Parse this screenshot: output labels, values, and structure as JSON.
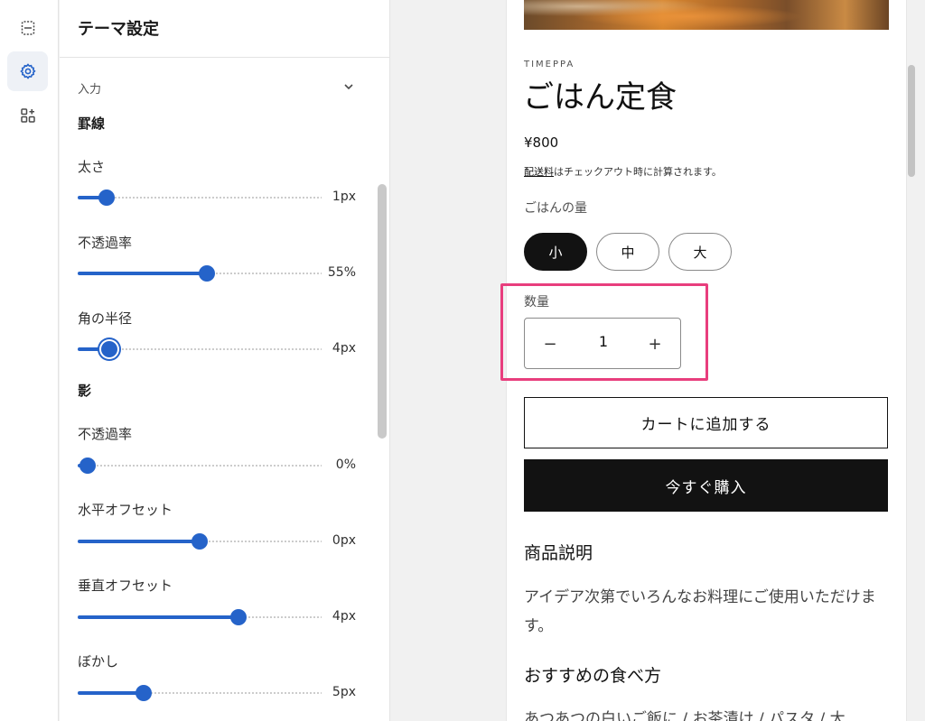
{
  "rail": {
    "items": [
      {
        "name": "sections-icon"
      },
      {
        "name": "settings-gear-icon"
      },
      {
        "name": "apps-add-icon"
      }
    ]
  },
  "panel": {
    "title": "テーマ設定",
    "section_label": "入力",
    "border_group": {
      "heading": "罫線",
      "settings": [
        {
          "label": "太さ",
          "value": "1px",
          "fraction": 0.12
        },
        {
          "label": "不透過率",
          "value": "55%",
          "fraction": 0.53
        },
        {
          "label": "角の半径",
          "value": "4px",
          "fraction": 0.13
        }
      ]
    },
    "shadow_group": {
      "heading": "影",
      "settings": [
        {
          "label": "不透過率",
          "value": "0%",
          "fraction": 0.04
        },
        {
          "label": "水平オフセット",
          "value": "0px",
          "fraction": 0.5
        },
        {
          "label": "垂直オフセット",
          "value": "4px",
          "fraction": 0.66
        },
        {
          "label": "ぼかし",
          "value": "5px",
          "fraction": 0.27
        }
      ]
    }
  },
  "preview": {
    "vendor": "TIMEPPA",
    "title": "ごはん定食",
    "price": "¥800",
    "shipping_link": "配送料",
    "shipping_rest": "はチェックアウト時に計算されます。",
    "variant_label": "ごはんの量",
    "variants": [
      "小",
      "中",
      "大"
    ],
    "selected_variant": "小",
    "quantity_label": "数量",
    "quantity_value": "1",
    "minus_symbol": "−",
    "plus_symbol": "+",
    "add_to_cart": "カートに追加する",
    "buy_now": "今すぐ購入",
    "description_heading": "商品説明",
    "description_text": "アイデア次第でいろんなお料理にご使用いただけます。",
    "howto_heading": "おすすめの食べ方",
    "howto_text": "あつあつの白いご飯に / お茶漬け / パスタ / 大"
  },
  "colors": {
    "accent": "#2563c9",
    "highlight": "#e83e7d",
    "button_dark": "#121212"
  }
}
